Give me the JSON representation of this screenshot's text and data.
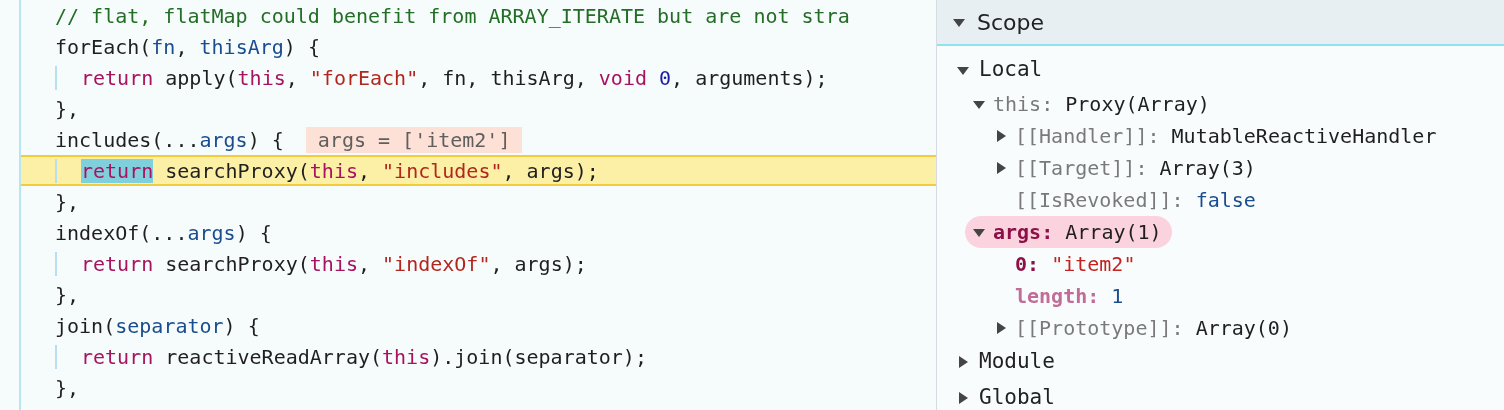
{
  "code": {
    "lines": [
      {
        "indented": false,
        "current": false,
        "tokens": [
          {
            "kind": "comment",
            "text": "// flat, flatMap could benefit from ARRAY_ITERATE but are not stra"
          }
        ]
      },
      {
        "indented": false,
        "current": false,
        "tokens": [
          {
            "kind": "plain",
            "text": "forEach("
          },
          {
            "kind": "param",
            "text": "fn"
          },
          {
            "kind": "plain",
            "text": ", "
          },
          {
            "kind": "param",
            "text": "thisArg"
          },
          {
            "kind": "plain",
            "text": ") {"
          }
        ]
      },
      {
        "indented": true,
        "current": false,
        "tokens": [
          {
            "kind": "keyword",
            "text": "return"
          },
          {
            "kind": "plain",
            "text": " apply("
          },
          {
            "kind": "keyword",
            "text": "this"
          },
          {
            "kind": "plain",
            "text": ", "
          },
          {
            "kind": "string",
            "text": "\"forEach\""
          },
          {
            "kind": "plain",
            "text": ", fn, thisArg, "
          },
          {
            "kind": "keyword",
            "text": "void "
          },
          {
            "kind": "number",
            "text": "0"
          },
          {
            "kind": "plain",
            "text": ", arguments);"
          }
        ]
      },
      {
        "indented": false,
        "current": false,
        "tokens": [
          {
            "kind": "plain",
            "text": "},"
          }
        ]
      },
      {
        "indented": false,
        "current": false,
        "inline_value": "args = ['item2']",
        "tokens": [
          {
            "kind": "plain",
            "text": "includes(..."
          },
          {
            "kind": "param",
            "text": "args"
          },
          {
            "kind": "plain",
            "text": ") {"
          }
        ]
      },
      {
        "indented": true,
        "current": true,
        "tokens": [
          {
            "kind": "keyword",
            "text": "return",
            "highlighted": true
          },
          {
            "kind": "plain",
            "text": " searchProxy("
          },
          {
            "kind": "keyword",
            "text": "this"
          },
          {
            "kind": "plain",
            "text": ", "
          },
          {
            "kind": "string",
            "text": "\"includes\""
          },
          {
            "kind": "plain",
            "text": ", args);"
          }
        ]
      },
      {
        "indented": false,
        "current": false,
        "tokens": [
          {
            "kind": "plain",
            "text": "},"
          }
        ]
      },
      {
        "indented": false,
        "current": false,
        "tokens": [
          {
            "kind": "plain",
            "text": "indexOf(..."
          },
          {
            "kind": "param",
            "text": "args"
          },
          {
            "kind": "plain",
            "text": ") {"
          }
        ]
      },
      {
        "indented": true,
        "current": false,
        "tokens": [
          {
            "kind": "keyword",
            "text": "return"
          },
          {
            "kind": "plain",
            "text": " searchProxy("
          },
          {
            "kind": "keyword",
            "text": "this"
          },
          {
            "kind": "plain",
            "text": ", "
          },
          {
            "kind": "string",
            "text": "\"indexOf\""
          },
          {
            "kind": "plain",
            "text": ", args);"
          }
        ]
      },
      {
        "indented": false,
        "current": false,
        "tokens": [
          {
            "kind": "plain",
            "text": "},"
          }
        ]
      },
      {
        "indented": false,
        "current": false,
        "tokens": [
          {
            "kind": "plain",
            "text": "join("
          },
          {
            "kind": "param",
            "text": "separator"
          },
          {
            "kind": "plain",
            "text": ") {"
          }
        ]
      },
      {
        "indented": true,
        "current": false,
        "tokens": [
          {
            "kind": "keyword",
            "text": "return"
          },
          {
            "kind": "plain",
            "text": " reactiveReadArray("
          },
          {
            "kind": "keyword",
            "text": "this"
          },
          {
            "kind": "plain",
            "text": ").join(separator);"
          }
        ]
      },
      {
        "indented": false,
        "current": false,
        "tokens": [
          {
            "kind": "plain",
            "text": "},"
          }
        ]
      }
    ]
  },
  "scope": {
    "title": "Scope",
    "expanded": true,
    "sections": [
      {
        "label": "Local",
        "expanded": true,
        "children": [
          {
            "label": {
              "kind": "plain",
              "text": "this:"
            },
            "value": {
              "kind": "object",
              "text": "Proxy(Array)"
            },
            "expanded": true,
            "highlighted": false,
            "children": [
              {
                "label": {
                  "kind": "internal",
                  "text": "[[Handler]]:"
                },
                "value": {
                  "kind": "object",
                  "text": "MutableReactiveHandler"
                },
                "expanded": false,
                "highlighted": false
              },
              {
                "label": {
                  "kind": "internal",
                  "text": "[[Target]]:"
                },
                "value": {
                  "kind": "object",
                  "text": "Array(3)"
                },
                "expanded": false,
                "highlighted": false
              },
              {
                "label": {
                  "kind": "internal",
                  "text": "[[IsRevoked]]:"
                },
                "value": {
                  "kind": "boolean",
                  "text": "false"
                },
                "highlighted": false
              }
            ]
          },
          {
            "label": {
              "kind": "own",
              "text": "args:"
            },
            "value": {
              "kind": "object",
              "text": "Array(1)"
            },
            "expanded": true,
            "highlighted": true,
            "children": [
              {
                "label": {
                  "kind": "own",
                  "text": "0:"
                },
                "value": {
                  "kind": "string",
                  "text": "\"item2\""
                },
                "highlighted": false
              },
              {
                "label": {
                  "kind": "hidden",
                  "text": "length:"
                },
                "value": {
                  "kind": "number",
                  "text": "1"
                },
                "highlighted": false
              },
              {
                "label": {
                  "kind": "internal",
                  "text": "[[Prototype]]:"
                },
                "value": {
                  "kind": "object",
                  "text": "Array(0)"
                },
                "expanded": false,
                "highlighted": false
              }
            ]
          }
        ]
      },
      {
        "label": "Module",
        "expanded": false
      },
      {
        "label": "Global",
        "expanded": false
      }
    ]
  }
}
